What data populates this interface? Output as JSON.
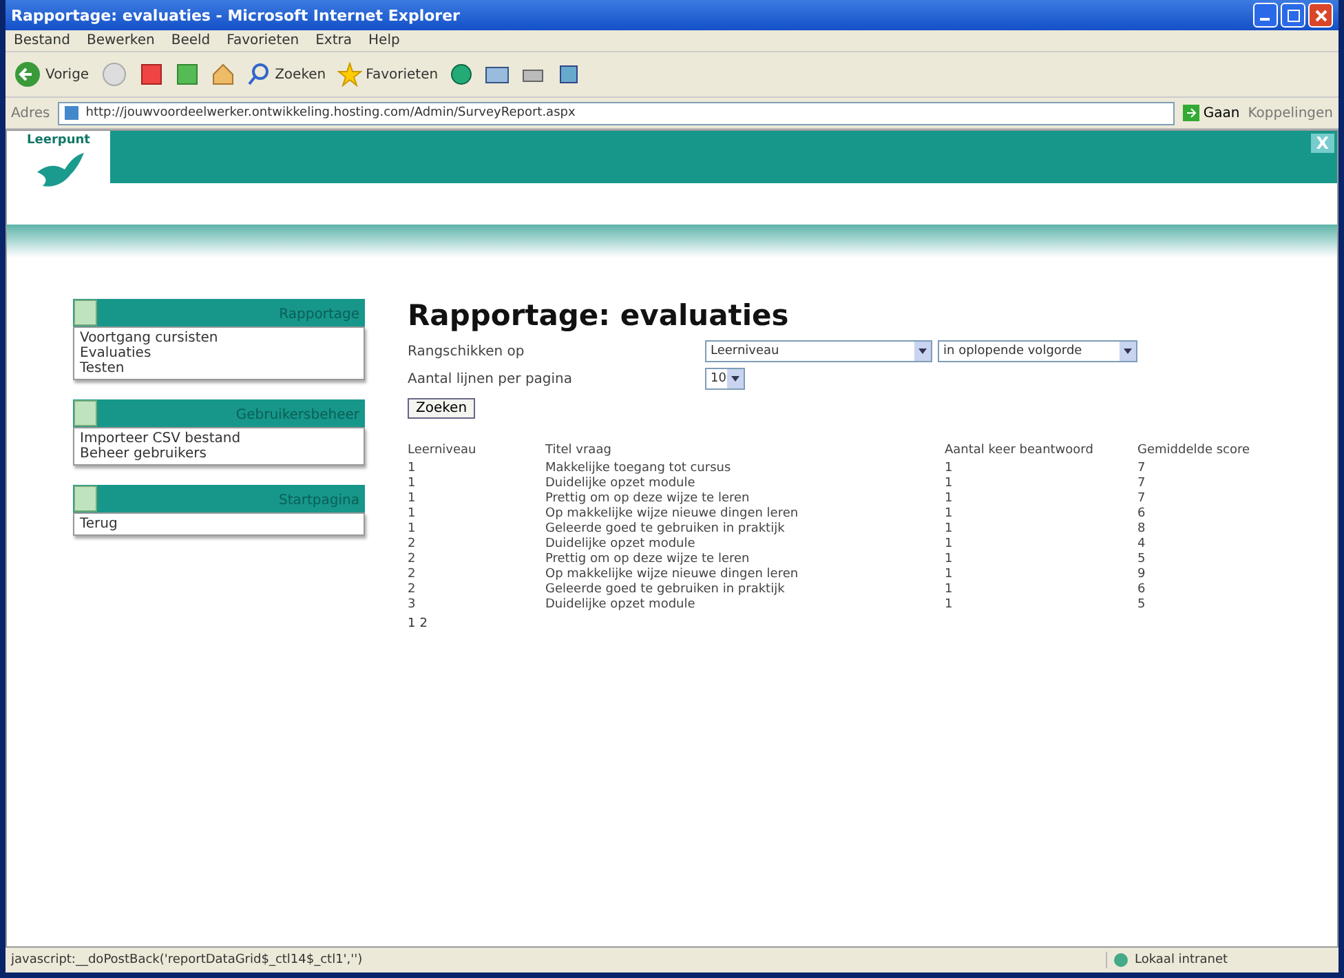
{
  "window": {
    "title": "Rapportage: evaluaties - Microsoft Internet Explorer"
  },
  "menu": [
    "Bestand",
    "Bewerken",
    "Beeld",
    "Favorieten",
    "Extra",
    "Help"
  ],
  "toolbar": {
    "back": "Vorige",
    "search": "Zoeken",
    "favorites": "Favorieten"
  },
  "address": {
    "label": "Adres",
    "url": "http://jouwvoordeelwerker.ontwikkeling.hosting.com/Admin/SurveyReport.aspx",
    "go": "Gaan",
    "links": "Koppelingen"
  },
  "site": {
    "logo": "Leerpunt",
    "close": "X"
  },
  "sidebar": [
    {
      "title": "Rapportage",
      "items": [
        "Voortgang cursisten",
        "Evaluaties",
        "Testen"
      ]
    },
    {
      "title": "Gebruikersbeheer",
      "items": [
        "Importeer CSV bestand",
        "Beheer gebruikers"
      ]
    },
    {
      "title": "Startpagina",
      "items": [
        "Terug"
      ]
    }
  ],
  "page": {
    "heading": "Rapportage: evaluaties",
    "sort_label": "Rangschikken op",
    "sort_value": "Leerniveau",
    "order_value": "in oplopende volgorde",
    "lines_label": "Aantal lijnen per pagina",
    "lines_value": "10",
    "button": "Zoeken"
  },
  "table": {
    "columns": [
      "Leerniveau",
      "Titel vraag",
      "Aantal keer beantwoord",
      "Gemiddelde score"
    ],
    "rows": [
      [
        "1",
        "Makkelijke toegang tot cursus",
        "1",
        "7"
      ],
      [
        "1",
        "Duidelijke opzet module",
        "1",
        "7"
      ],
      [
        "1",
        "Prettig om op deze wijze te leren",
        "1",
        "7"
      ],
      [
        "1",
        "Op makkelijke wijze nieuwe dingen leren",
        "1",
        "6"
      ],
      [
        "1",
        "Geleerde goed te gebruiken in praktijk",
        "1",
        "8"
      ],
      [
        "2",
        "Duidelijke opzet module",
        "1",
        "4"
      ],
      [
        "2",
        "Prettig om op deze wijze te leren",
        "1",
        "5"
      ],
      [
        "2",
        "Op makkelijke wijze nieuwe dingen leren",
        "1",
        "9"
      ],
      [
        "2",
        "Geleerde goed te gebruiken in praktijk",
        "1",
        "6"
      ],
      [
        "3",
        "Duidelijke opzet module",
        "1",
        "5"
      ]
    ],
    "pages": [
      "1",
      "2"
    ]
  },
  "status_bar": {
    "text": "javascript:__doPostBack('reportDataGrid$_ctl14$_ctl1','')",
    "zone": "Lokaal intranet"
  }
}
